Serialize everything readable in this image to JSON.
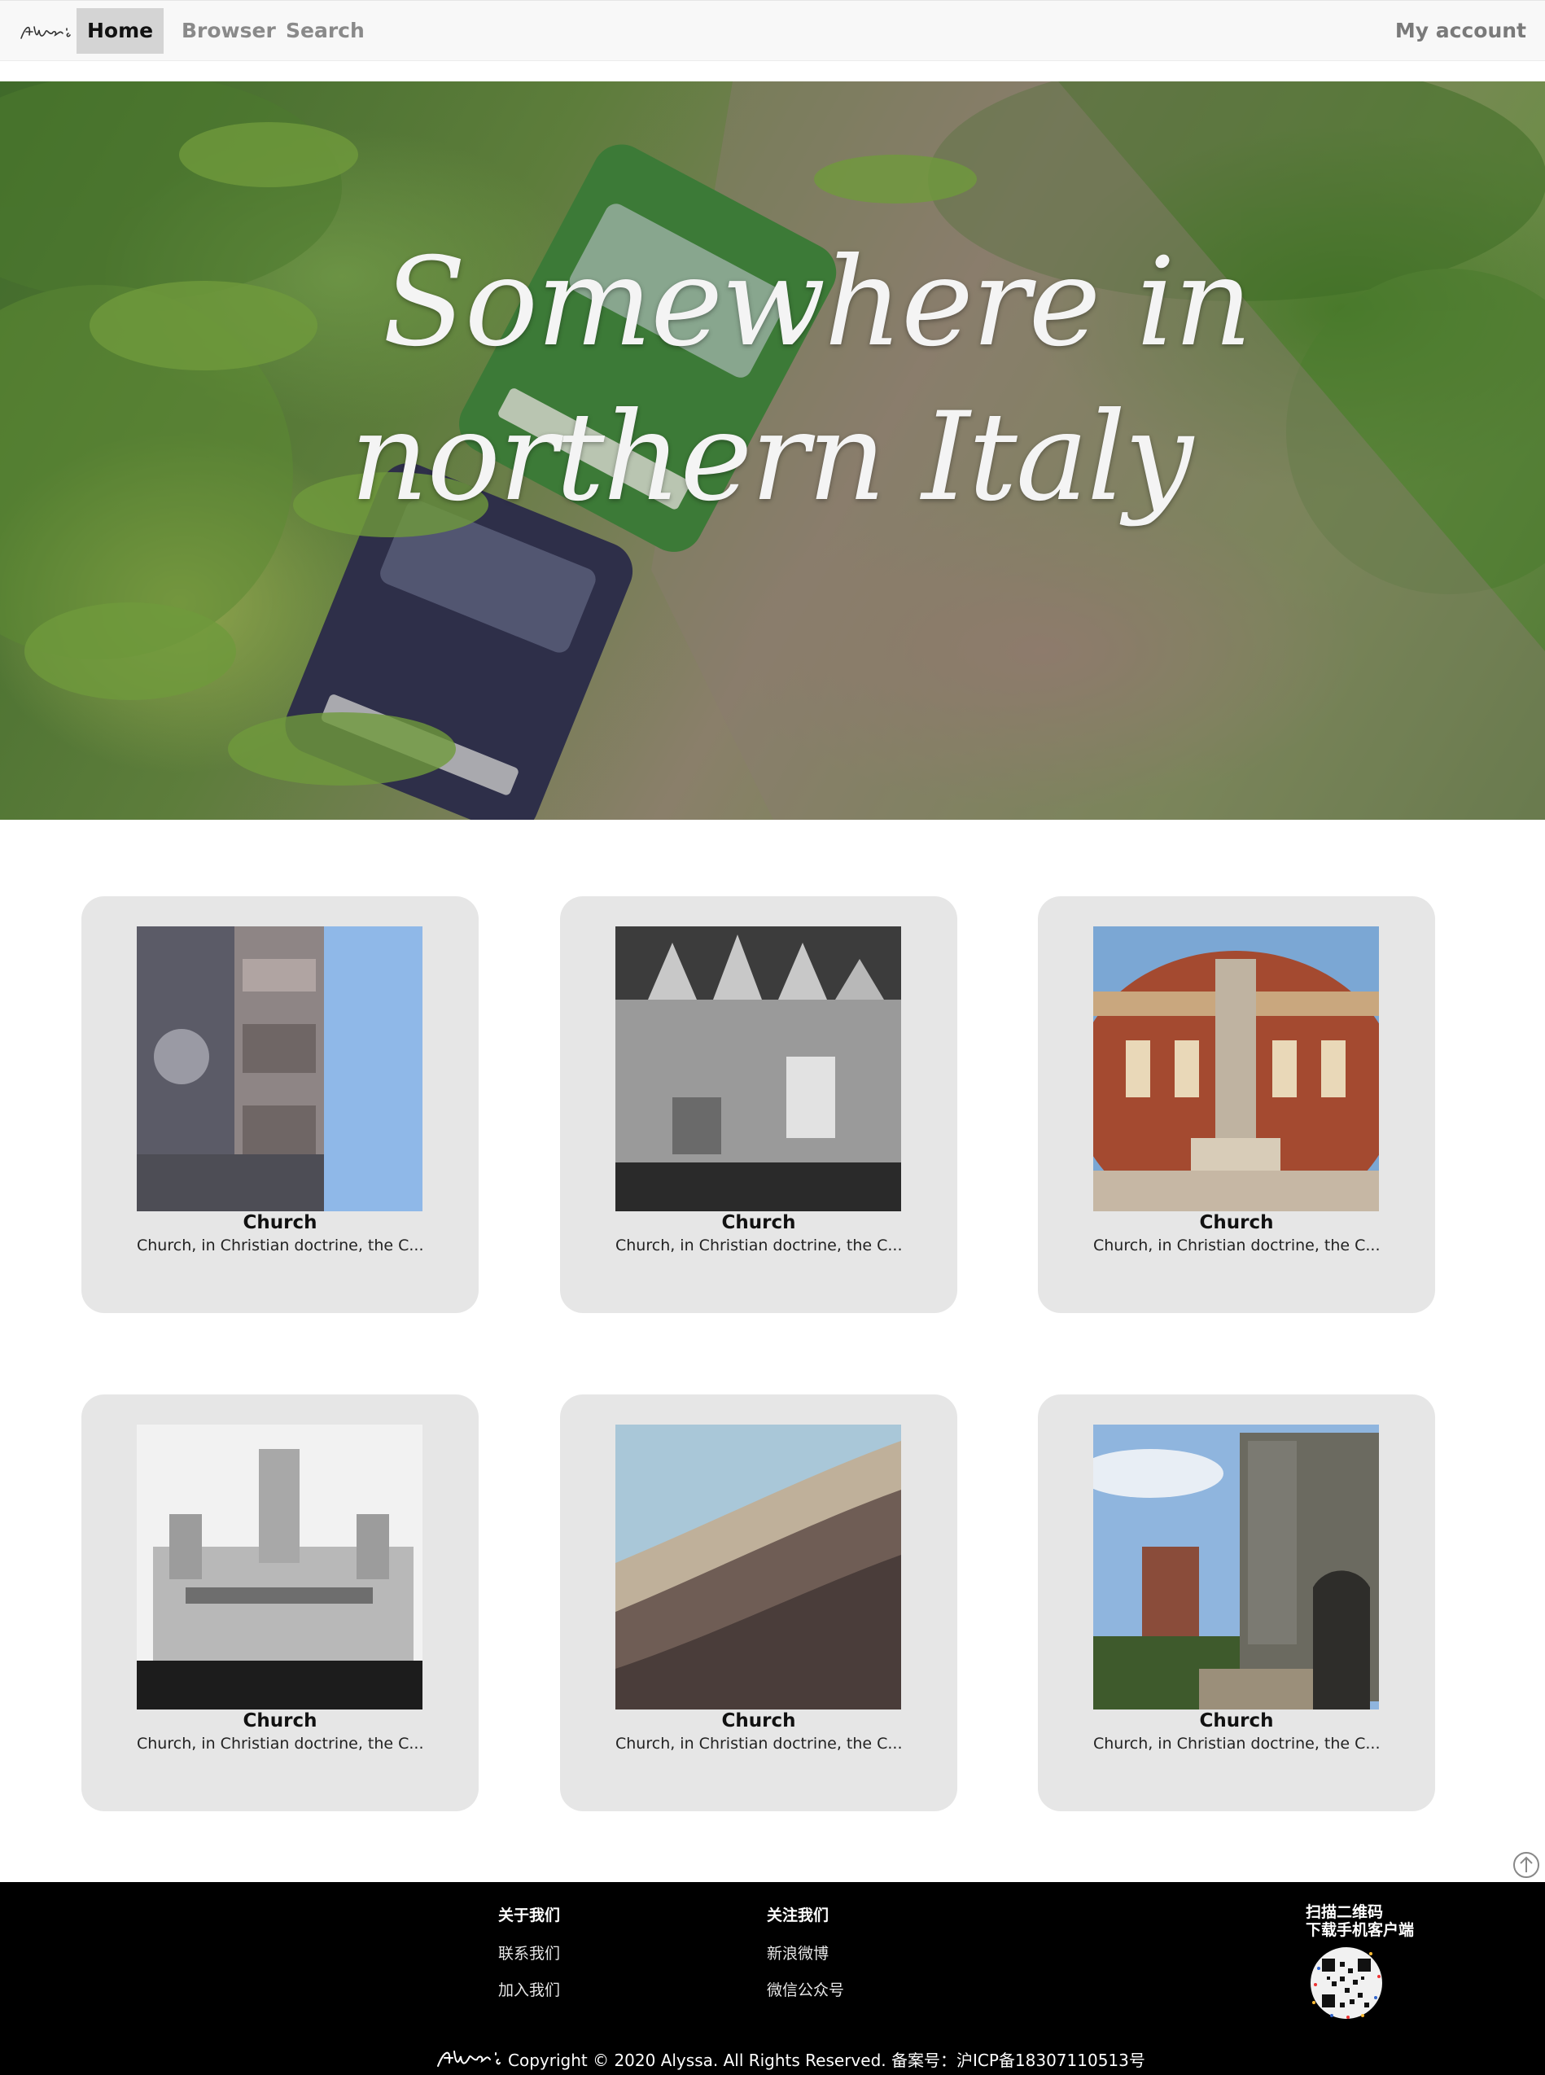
{
  "nav": {
    "logo_text": "Alyssa's",
    "items": [
      {
        "label": "Home",
        "active": true
      },
      {
        "label": "Browser",
        "active": false
      },
      {
        "label": "Search",
        "active": false
      }
    ],
    "account": "My account"
  },
  "hero": {
    "line1": "Somewhere in",
    "line2": "northern Italy"
  },
  "cards": [
    {
      "title": "Church",
      "desc": "Church, in Christian doctrine, the C..."
    },
    {
      "title": "Church",
      "desc": "Church, in Christian doctrine, the C..."
    },
    {
      "title": "Church",
      "desc": "Church, in Christian doctrine, the C..."
    },
    {
      "title": "Church",
      "desc": "Church, in Christian doctrine, the C..."
    },
    {
      "title": "Church",
      "desc": "Church, in Christian doctrine, the C..."
    },
    {
      "title": "Church",
      "desc": "Church, in Christian doctrine, the C..."
    }
  ],
  "footer": {
    "about_heading": "关于我们",
    "about_links": [
      "联系我们",
      "加入我们"
    ],
    "follow_heading": "关注我们",
    "follow_links": [
      "新浪微博",
      "微信公众号"
    ],
    "qr_line1": "扫描二维码",
    "qr_line2": "下载手机客户端",
    "copyright": "Copyright © 2020 Alyssa. All Rights Reserved. 备案号：沪ICP备18307110513号"
  },
  "icons": {
    "back_to_top": "arrow-up-circle-icon",
    "refresh": "refresh-icon"
  }
}
